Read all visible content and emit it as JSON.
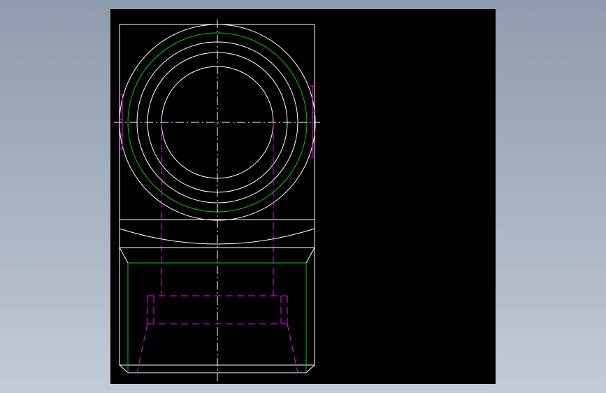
{
  "viewer": {
    "background": "#000000",
    "frame_color": "#8e9caf"
  },
  "drawing": {
    "colors": {
      "outline": "#ffffff",
      "centerline": "#ffffff",
      "thread_ring": "#00cc00",
      "hidden": "#ff00ff"
    },
    "views": [
      "top-view",
      "front-view"
    ]
  }
}
